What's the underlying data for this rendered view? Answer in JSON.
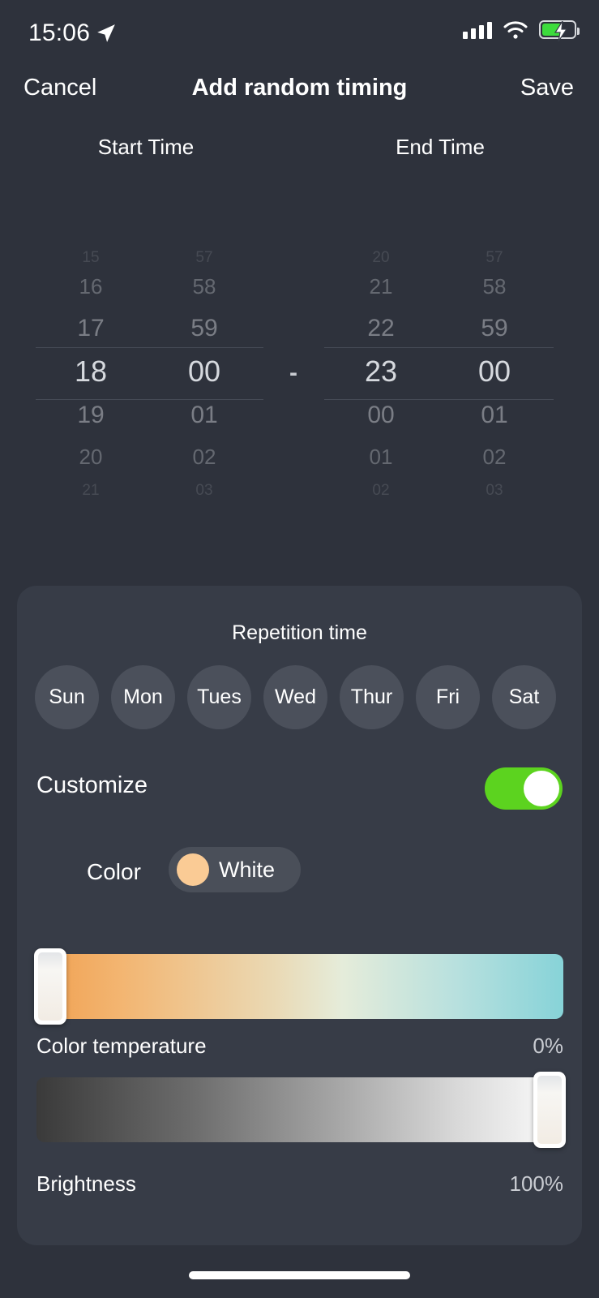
{
  "status_bar": {
    "time": "15:06",
    "location_icon": "location-arrow-icon",
    "signal_icon": "cellular-signal-icon",
    "wifi_icon": "wifi-icon",
    "battery_icon": "battery-charging-icon",
    "battery_level_percent": 62,
    "battery_color": "#3ddc3d"
  },
  "nav": {
    "cancel_label": "Cancel",
    "title": "Add random timing",
    "save_label": "Save"
  },
  "time_picker": {
    "start_header": "Start Time",
    "end_header": "End Time",
    "separator": "-",
    "start": {
      "hour_selected": "18",
      "minute_selected": "00",
      "hours": [
        "15",
        "16",
        "17",
        "18",
        "19",
        "20",
        "21"
      ],
      "minutes": [
        "57",
        "58",
        "59",
        "00",
        "01",
        "02",
        "03"
      ]
    },
    "end": {
      "hour_selected": "23",
      "minute_selected": "00",
      "hours": [
        "20",
        "21",
        "22",
        "23",
        "00",
        "01",
        "02"
      ],
      "minutes": [
        "57",
        "58",
        "59",
        "00",
        "01",
        "02",
        "03"
      ]
    }
  },
  "card": {
    "repetition_title": "Repetition time",
    "days": [
      {
        "label": "Sun",
        "selected": false
      },
      {
        "label": "Mon",
        "selected": false
      },
      {
        "label": "Tues",
        "selected": false
      },
      {
        "label": "Wed",
        "selected": false
      },
      {
        "label": "Thur",
        "selected": false
      },
      {
        "label": "Fri",
        "selected": false
      },
      {
        "label": "Sat",
        "selected": false
      }
    ],
    "customize": {
      "label": "Customize",
      "enabled": true,
      "on_color": "#5cd31f"
    },
    "color_row": {
      "label": "Color",
      "value": "White",
      "swatch_color": "#facb95"
    },
    "color_temperature": {
      "label": "Color temperature",
      "value": "0%",
      "percent": 0
    },
    "brightness": {
      "label": "Brightness",
      "value": "100%",
      "percent": 100
    }
  },
  "home_indicator": "home-indicator"
}
